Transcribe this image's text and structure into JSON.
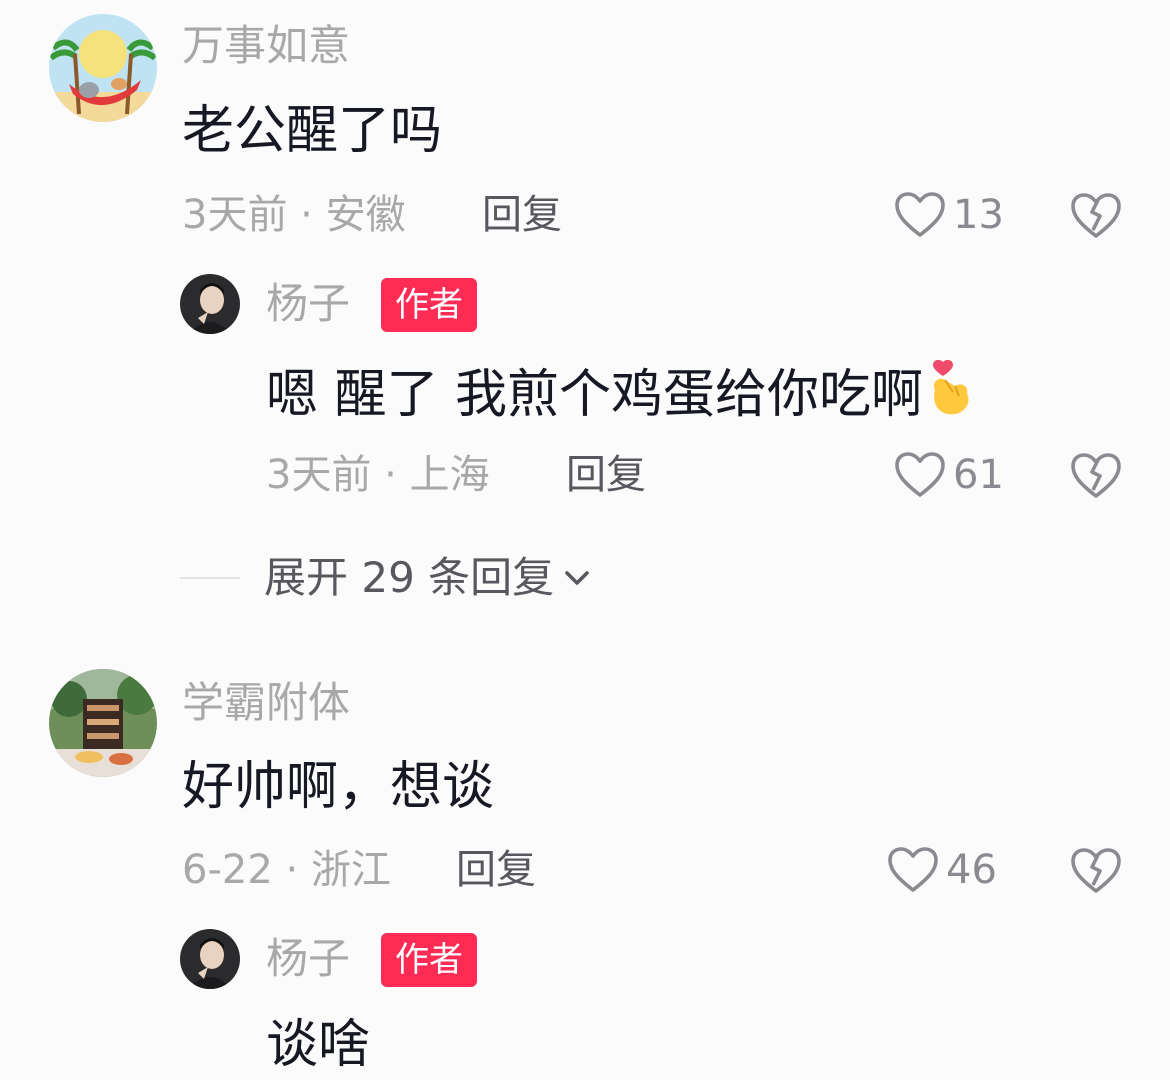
{
  "comments": [
    {
      "username": "万事如意",
      "avatar_icon": "hammock-cartoon-avatar",
      "text": "老公醒了吗",
      "time": "3天前",
      "location": "安徽",
      "reply_label": "回复",
      "likes": "13",
      "replies": [
        {
          "username": "杨子",
          "badge": "作者",
          "avatar_icon": "man-portrait-avatar",
          "text": "嗯 醒了 我煎个鸡蛋给你吃啊",
          "emoji": "finger-heart-emoji",
          "time": "3天前",
          "location": "上海",
          "reply_label": "回复",
          "likes": "61"
        }
      ],
      "expand_label": "展开 29 条回复"
    },
    {
      "username": "学霸附体",
      "avatar_icon": "garden-table-avatar",
      "text": "好帅啊，想谈",
      "time": "6-22",
      "location": "浙江",
      "reply_label": "回复",
      "likes": "46",
      "replies": [
        {
          "username": "杨子",
          "badge": "作者",
          "avatar_icon": "man-portrait-avatar",
          "text": "谈啥"
        }
      ]
    }
  ],
  "colors": {
    "background": "#fbfbfb",
    "author_badge": "#fe2c55",
    "muted_text": "#a8a8ab",
    "primary_text": "#161823"
  }
}
